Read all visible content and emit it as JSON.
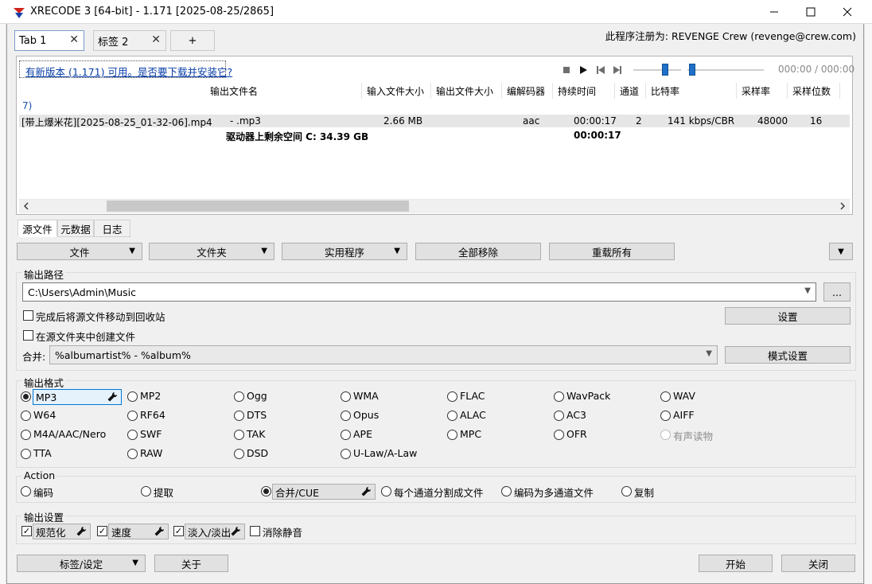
{
  "window": {
    "title": "XRECODE 3 [64-bit] - 1.171 [2025-08-25/2865]"
  },
  "tabs": [
    {
      "label": "Tab 1",
      "active": true
    },
    {
      "label": "标签 2",
      "active": false
    }
  ],
  "new_tab_label": "+",
  "registration": "此程序注册为: REVENGE Crew (revenge@crew.com)",
  "update_notice": "有新版本 (1.171) 可用。是否要下载并安装它?",
  "player": {
    "time": "000:00 / 000:00"
  },
  "file_table": {
    "columns": [
      "输出文件名",
      "输入文件大小",
      "输出文件大小",
      "编解码器",
      "持续时间",
      "通道",
      "比特率",
      "采样率",
      "采样位数"
    ],
    "group_label": "7)",
    "rows": [
      {
        "name": "[带上爆米花][2025-08-25_01-32-06].mp4",
        "output": "- .mp3",
        "input_size": "2.66 MB",
        "output_size": "",
        "codec": "aac",
        "duration": "00:00:17",
        "channels": "2",
        "bitrate": "141 kbps/CBR",
        "samplerate": "48000",
        "bits": "16"
      }
    ],
    "footer": {
      "free_space": "驱动器上剩余空间 C: 34.39 GB",
      "total_duration": "00:00:17"
    }
  },
  "subtabs": [
    "源文件",
    "元数据",
    "日志"
  ],
  "actions": {
    "files": "文件",
    "folder": "文件夹",
    "utilities": "实用程序",
    "remove_all": "全部移除",
    "reset_all": "重载所有"
  },
  "output_path": {
    "title": "输出路径",
    "path": "C:\\Users\\Admin\\Music",
    "browse": "...",
    "move_to_recycle": "完成后将源文件移动到回收站",
    "create_in_source": "在源文件夹中创建文件",
    "settings": "设置",
    "merge_label": "合并:",
    "merge_pattern": "%albumartist% - %album%",
    "pattern_settings": "模式设置"
  },
  "output_format": {
    "title": "输出格式",
    "options": [
      [
        "MP3",
        "MP2",
        "Ogg",
        "WMA",
        "FLAC",
        "WavPack",
        "WAV"
      ],
      [
        "W64",
        "RF64",
        "DTS",
        "Opus",
        "ALAC",
        "AC3",
        "AIFF"
      ],
      [
        "M4A/AAC/Nero",
        "SWF",
        "TAK",
        "APE",
        "MPC",
        "OFR",
        "有声读物"
      ],
      [
        "TTA",
        "RAW",
        "DSD",
        "U-Law/A-Law"
      ]
    ],
    "selected": "MP3"
  },
  "action_group": {
    "title": "Action",
    "options": [
      "编码",
      "提取",
      "合并/CUE",
      "每个通道分割成文件",
      "编码为多通道文件",
      "复制"
    ],
    "selected": "合并/CUE"
  },
  "output_settings": {
    "title": "输出设置",
    "normalize": "规范化",
    "speed": "速度",
    "fade": "淡入/淡出",
    "remove_silence": "消除静音"
  },
  "bottom": {
    "tags_settings": "标签/设定",
    "about": "关于",
    "start": "开始",
    "close": "关闭"
  }
}
